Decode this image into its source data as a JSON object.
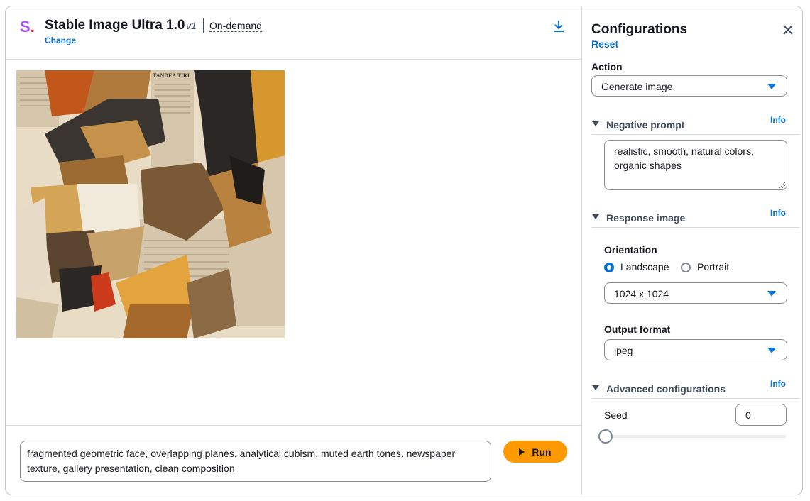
{
  "header": {
    "logo_letter": "S",
    "logo_dot": ".",
    "model_name": "Stable Image Ultra 1.0",
    "version": "v1",
    "mode": "On-demand",
    "change_link": "Change",
    "download_icon": "download-icon"
  },
  "image": {
    "icon": "generated-image",
    "newspaper_headline": "TANDEA TIRI"
  },
  "prompt": {
    "text": "fragmented geometric face, overlapping planes, analytical cubism, muted earth tones, newspaper texture, gallery presentation, clean composition",
    "run_label": "Run",
    "run_icon": "play-icon"
  },
  "config": {
    "title": "Configurations",
    "reset": "Reset",
    "close_icon": "close-icon",
    "action": {
      "label": "Action",
      "value": "Generate image"
    },
    "negative_prompt": {
      "title": "Negative prompt",
      "info": "Info",
      "value": "realistic, smooth, natural colors, organic shapes"
    },
    "response_image": {
      "title": "Response image",
      "info": "Info",
      "orientation_label": "Orientation",
      "options": [
        {
          "label": "Landscape",
          "selected": true
        },
        {
          "label": "Portrait",
          "selected": false
        }
      ],
      "size": "1024 x 1024",
      "output_format_label": "Output format",
      "output_format": "jpeg"
    },
    "advanced": {
      "title": "Advanced configurations",
      "info": "Info",
      "seed_label": "Seed",
      "seed_value": "0",
      "seed_slider_fraction": 0
    }
  },
  "colors": {
    "accent": "#0972d3",
    "run_button": "#ff9900",
    "logo_s": "#a855f7",
    "logo_dot": "#e11d48"
  }
}
